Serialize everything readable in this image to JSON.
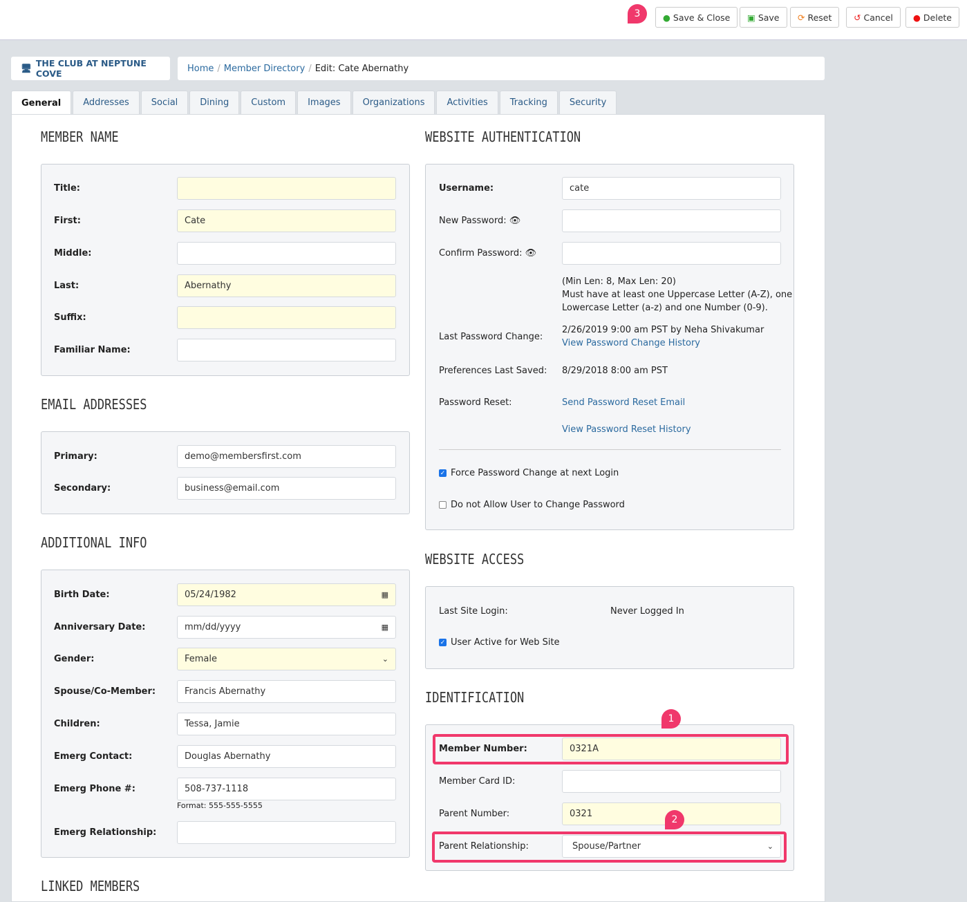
{
  "toolbar": {
    "save_close": "Save & Close",
    "save": "Save",
    "reset": "Reset",
    "cancel": "Cancel",
    "delete": "Delete",
    "badge": "3"
  },
  "brand": "THE CLUB AT NEPTUNE COVE",
  "breadcrumb": [
    "Home",
    "Member Directory",
    "Edit: Cate Abernathy"
  ],
  "tabs": [
    "General",
    "Addresses",
    "Social",
    "Dining",
    "Custom",
    "Images",
    "Organizations",
    "Activities",
    "Tracking",
    "Security"
  ],
  "member_name": {
    "heading": "MEMBER NAME",
    "fields": [
      {
        "label": "Title:",
        "value": ""
      },
      {
        "label": "First:",
        "value": "Cate"
      },
      {
        "label": "Middle:",
        "value": ""
      },
      {
        "label": "Last:",
        "value": "Abernathy"
      },
      {
        "label": "Suffix:",
        "value": ""
      },
      {
        "label": "Familiar Name:",
        "value": ""
      }
    ]
  },
  "email": {
    "heading": "EMAIL ADDRESSES",
    "fields": [
      {
        "label": "Primary:",
        "value": "demo@membersfirst.com"
      },
      {
        "label": "Secondary:",
        "value": "business@email.com"
      }
    ]
  },
  "additional": {
    "heading": "ADDITIONAL INFO",
    "fields": [
      {
        "label": "Birth Date:",
        "value": "05/24/1982"
      },
      {
        "label": "Anniversary Date:",
        "value": "mm/dd/yyyy"
      },
      {
        "label": "Gender:",
        "value": "Female"
      },
      {
        "label": "Spouse/Co-Member:",
        "value": "Francis Abernathy"
      },
      {
        "label": "Children:",
        "value": "Tessa, Jamie"
      },
      {
        "label": "Emerg Contact:",
        "value": "Douglas Abernathy"
      },
      {
        "label": "Emerg Phone #:",
        "value": "508-737-1118"
      },
      {
        "label": "Emerg Relationship:",
        "value": ""
      }
    ],
    "phone_format": "Format: 555-555-5555"
  },
  "linked_heading": "LINKED MEMBERS",
  "auth": {
    "heading": "WEBSITE AUTHENTICATION",
    "username_label": "Username:",
    "username": "cate",
    "new_pw_label": "New Password:",
    "confirm_pw_label": "Confirm Password:",
    "pw_rules": [
      "(Min Len: 8, Max Len: 20)",
      "Must have at least one Uppercase Letter (A-Z), one",
      "Lowercase Letter (a-z) and one Number (0-9)."
    ],
    "last_change_label": "Last Password Change:",
    "last_change": "2/26/2019 9:00 am PST by Neha Shivakumar",
    "change_history": "View Password Change History",
    "prefs_label": "Preferences Last Saved:",
    "prefs": "8/29/2018 8:00 am PST",
    "reset_label": "Password Reset:",
    "send_reset": "Send Password Reset Email",
    "reset_history": "View Password Reset History",
    "force_change": "Force Password Change at next Login",
    "force_change_checked": true,
    "no_change": "Do not Allow User to Change Password",
    "no_change_checked": false
  },
  "access": {
    "heading": "WEBSITE ACCESS",
    "last_login_label": "Last Site Login:",
    "last_login": "Never Logged In",
    "active": "User Active for Web Site",
    "active_checked": true
  },
  "ident": {
    "heading": "IDENTIFICATION",
    "member_number_label": "Member Number:",
    "member_number": "0321A",
    "card_label": "Member Card ID:",
    "card": "",
    "parent_label": "Parent Number:",
    "parent": "0321",
    "rel_label": "Parent Relationship:",
    "rel": "Spouse/Partner",
    "badge1": "1",
    "badge2": "2"
  },
  "colors": {
    "accent": "#2b6a9f",
    "highlight": "#f0386b",
    "required_bg": "#fffde0"
  }
}
